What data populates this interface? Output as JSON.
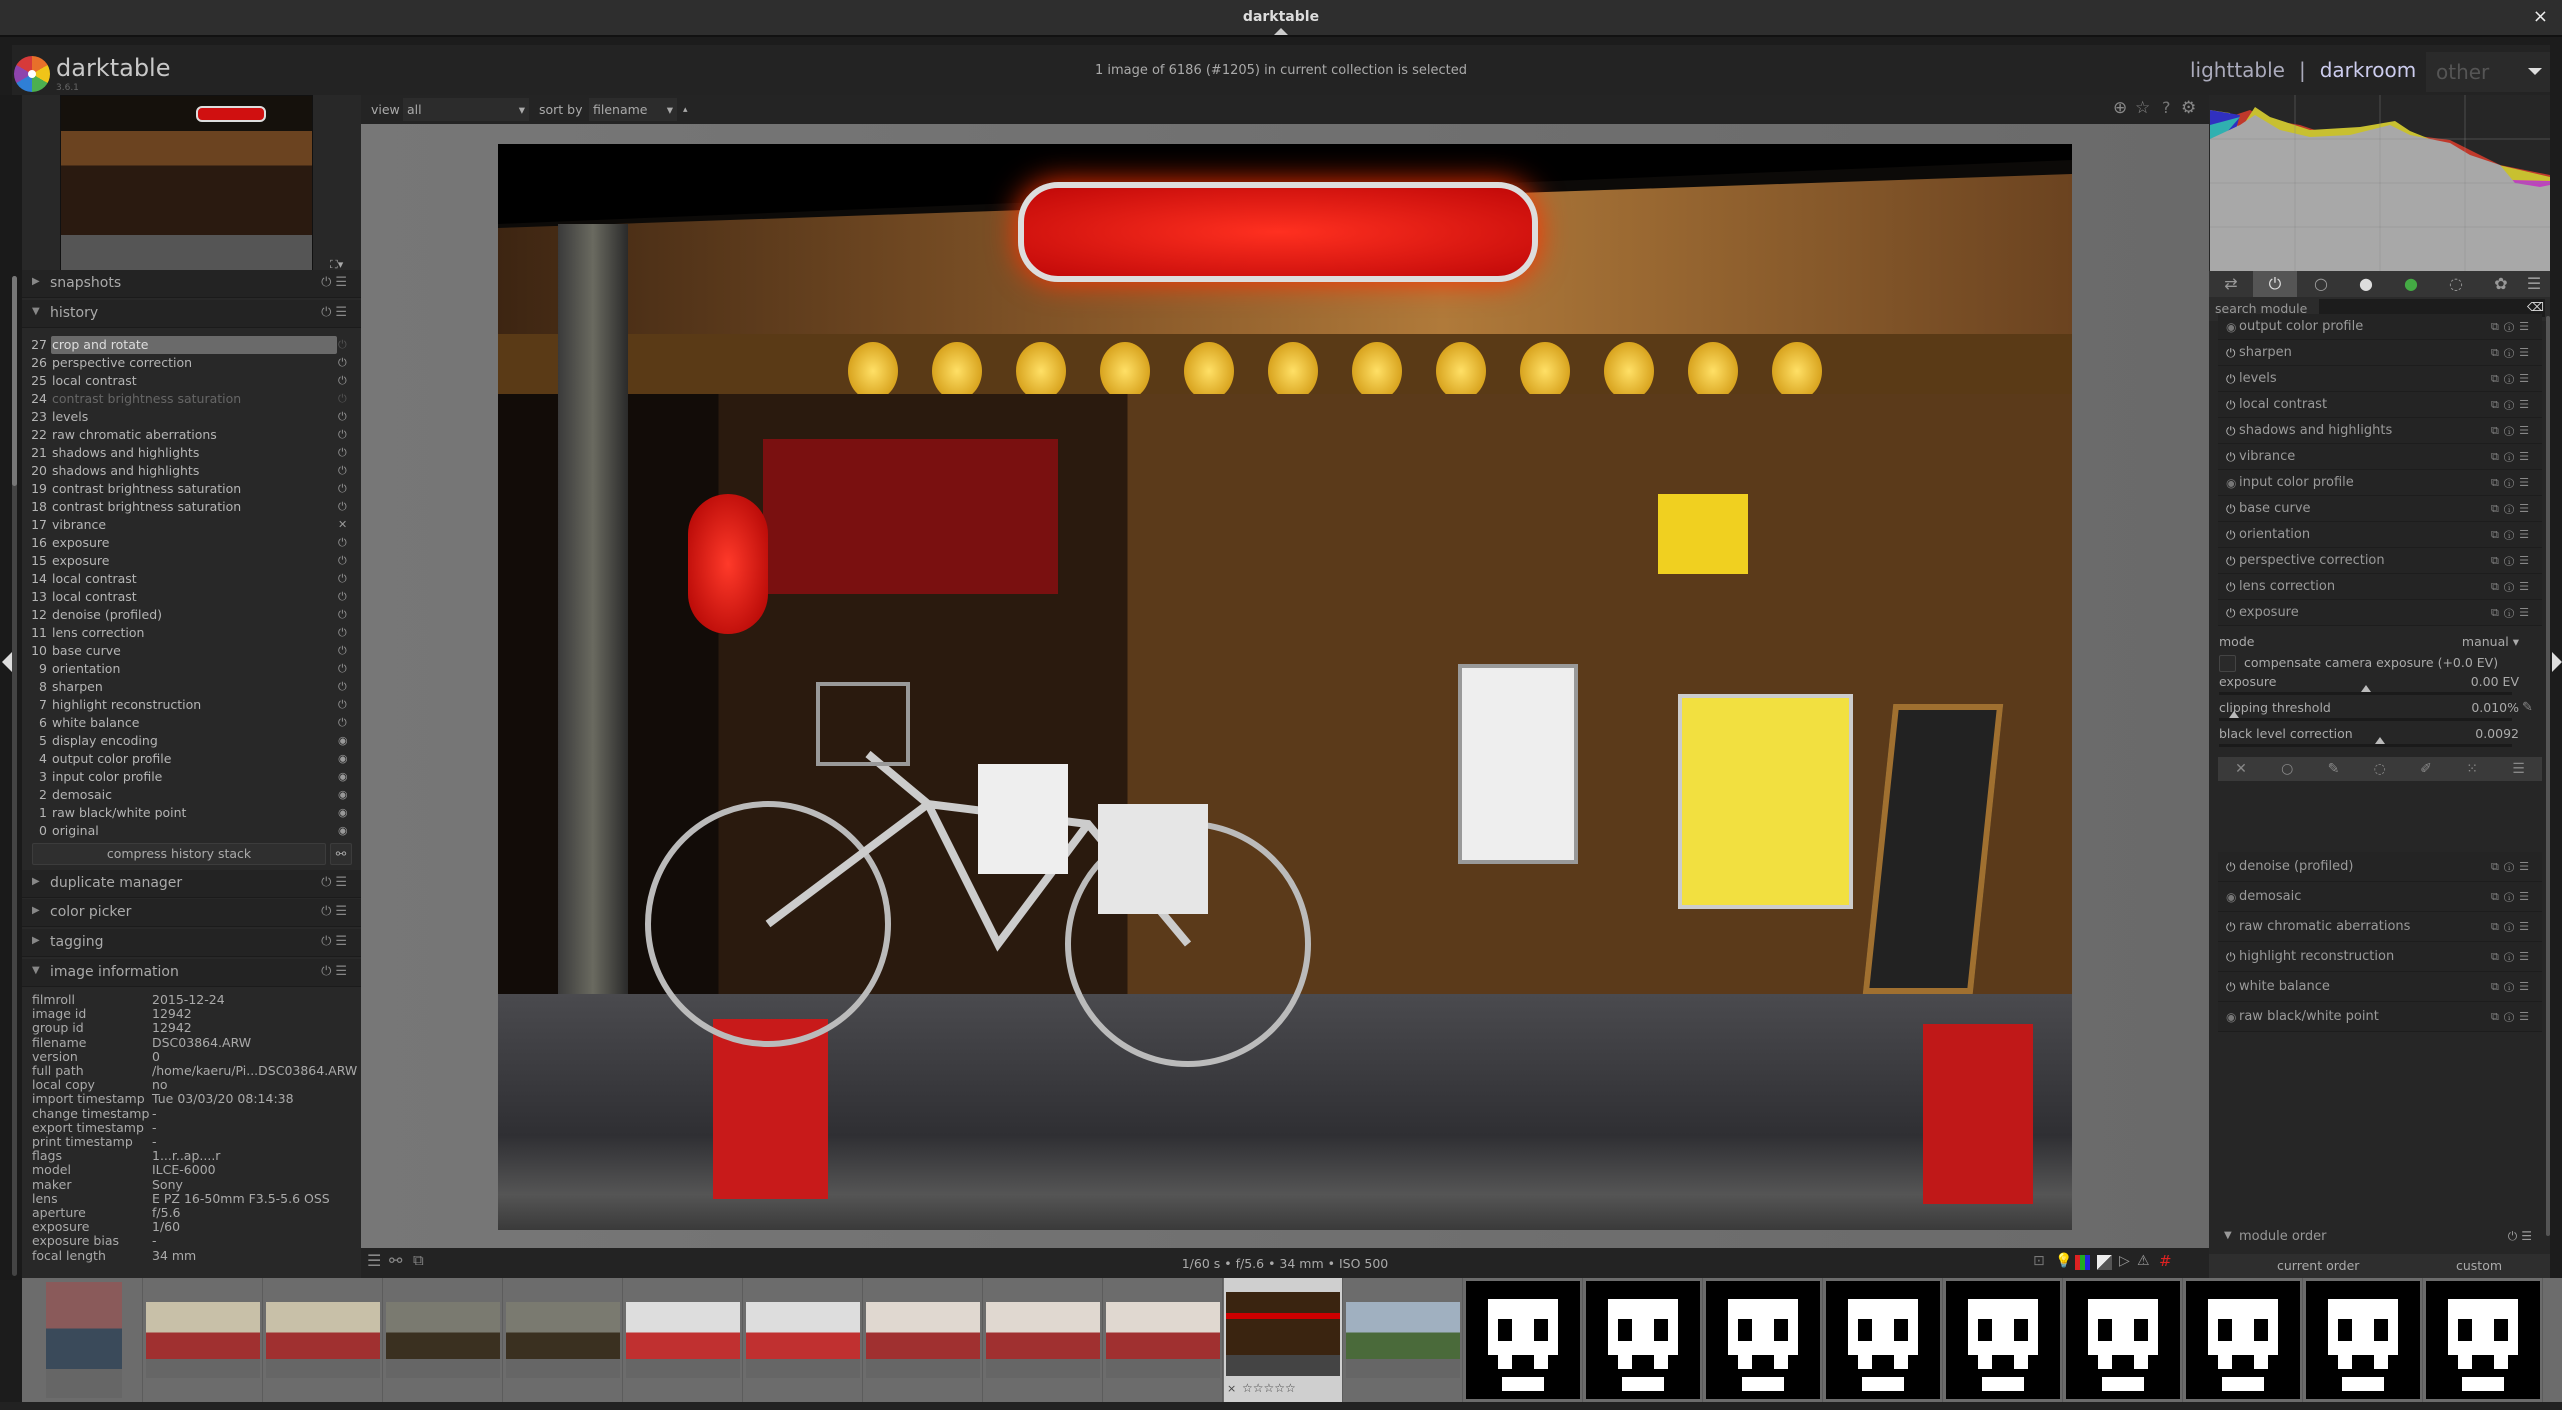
{
  "window": {
    "title": "darktable",
    "close": "×"
  },
  "header": {
    "brand": "darktable",
    "version": "3.6.1",
    "collection_status": "1 image of 6186 (#1205) in current collection is selected",
    "views": {
      "lighttable": "lighttable",
      "sep": "|",
      "darkroom": "darkroom",
      "other": "other"
    }
  },
  "toolbar": {
    "view_label": "view",
    "view_value": "all",
    "sort_label": "sort by",
    "sort_value": "filename",
    "sort_dir": "▴"
  },
  "left_panel": {
    "snapshots": "snapshots",
    "history_title": "history",
    "history": [
      {
        "n": "27",
        "label": "crop and rotate",
        "state": "off-dim",
        "selected": true
      },
      {
        "n": "26",
        "label": "perspective correction",
        "state": "on"
      },
      {
        "n": "25",
        "label": "local contrast",
        "state": "on"
      },
      {
        "n": "24",
        "label": "contrast brightness saturation",
        "state": "off-dim",
        "dim": true
      },
      {
        "n": "23",
        "label": "levels",
        "state": "on"
      },
      {
        "n": "22",
        "label": "raw chromatic aberrations",
        "state": "on"
      },
      {
        "n": "21",
        "label": "shadows and highlights",
        "state": "on"
      },
      {
        "n": "20",
        "label": "shadows and highlights",
        "state": "on"
      },
      {
        "n": "19",
        "label": "contrast brightness saturation",
        "state": "on"
      },
      {
        "n": "18",
        "label": "contrast brightness saturation",
        "state": "on"
      },
      {
        "n": "17",
        "label": "vibrance",
        "state": "deleted"
      },
      {
        "n": "16",
        "label": "exposure",
        "state": "on"
      },
      {
        "n": "15",
        "label": "exposure",
        "state": "on"
      },
      {
        "n": "14",
        "label": "local contrast",
        "state": "on"
      },
      {
        "n": "13",
        "label": "local contrast",
        "state": "on"
      },
      {
        "n": "12",
        "label": "denoise (profiled)",
        "state": "on"
      },
      {
        "n": "11",
        "label": "lens correction",
        "state": "on"
      },
      {
        "n": "10",
        "label": "base curve",
        "state": "on"
      },
      {
        "n": "9",
        "label": "orientation",
        "state": "on"
      },
      {
        "n": "8",
        "label": "sharpen",
        "state": "on"
      },
      {
        "n": "7",
        "label": "highlight reconstruction",
        "state": "on"
      },
      {
        "n": "6",
        "label": "white balance",
        "state": "on"
      },
      {
        "n": "5",
        "label": "display encoding",
        "state": "always"
      },
      {
        "n": "4",
        "label": "output color profile",
        "state": "always"
      },
      {
        "n": "3",
        "label": "input color profile",
        "state": "always"
      },
      {
        "n": "2",
        "label": "demosaic",
        "state": "always"
      },
      {
        "n": "1",
        "label": "raw black/white point",
        "state": "always"
      },
      {
        "n": "0",
        "label": "original",
        "state": "always"
      }
    ],
    "compress": "compress history stack",
    "duplicate_manager": "duplicate manager",
    "color_picker": "color picker",
    "tagging": "tagging",
    "image_information": "image information",
    "info": [
      {
        "k": "filmroll",
        "v": "2015-12-24"
      },
      {
        "k": "image id",
        "v": "12942"
      },
      {
        "k": "group id",
        "v": "12942"
      },
      {
        "k": "filename",
        "v": "DSC03864.ARW"
      },
      {
        "k": "version",
        "v": "0"
      },
      {
        "k": "full path",
        "v": "/home/kaeru/Pi...DSC03864.ARW"
      },
      {
        "k": "local copy",
        "v": "no"
      },
      {
        "k": "import timestamp",
        "v": "Tue 03/03/20 08:14:38"
      },
      {
        "k": "change timestamp",
        "v": "-"
      },
      {
        "k": "export timestamp",
        "v": "-"
      },
      {
        "k": "print timestamp",
        "v": "-"
      },
      {
        "k": "flags",
        "v": "1...r..ap....r"
      },
      {
        "k": "model",
        "v": "ILCE-6000"
      },
      {
        "k": "maker",
        "v": "Sony"
      },
      {
        "k": "lens",
        "v": "E PZ 16-50mm F3.5-5.6 OSS"
      },
      {
        "k": "aperture",
        "v": "f/5.6"
      },
      {
        "k": "exposure",
        "v": "1/60"
      },
      {
        "k": "exposure bias",
        "v": "-"
      },
      {
        "k": "focal length",
        "v": "34 mm"
      }
    ]
  },
  "bottom": {
    "exif": "1/60 s • f/5.6 • 34 mm • ISO 500"
  },
  "right_panel": {
    "search_label": "search module",
    "search_value": "",
    "modules_top": [
      {
        "label": "output color profile",
        "always": true
      },
      {
        "label": "sharpen"
      },
      {
        "label": "levels"
      },
      {
        "label": "local contrast"
      },
      {
        "label": "shadows and highlights"
      },
      {
        "label": "vibrance"
      },
      {
        "label": "input color profile",
        "always": true
      },
      {
        "label": "base curve"
      },
      {
        "label": "orientation"
      },
      {
        "label": "perspective correction"
      },
      {
        "label": "lens correction"
      },
      {
        "label": "exposure"
      }
    ],
    "exposure": {
      "mode_label": "mode",
      "mode_value": "manual",
      "compensate": "compensate camera exposure (+0.0 EV)",
      "compensate_checked": false,
      "exposure_label": "exposure",
      "exposure_value": "0.00 EV",
      "exposure_pos": 0.5,
      "clip_label": "clipping threshold",
      "clip_value": "0.010%",
      "clip_pos": 0.05,
      "black_label": "black level correction",
      "black_value": "0.0092",
      "black_pos": 0.55
    },
    "modules_bottom": [
      {
        "label": "denoise (profiled)"
      },
      {
        "label": "demosaic",
        "always": true
      },
      {
        "label": "raw chromatic aberrations"
      },
      {
        "label": "highlight reconstruction"
      },
      {
        "label": "white balance"
      },
      {
        "label": "raw black/white point",
        "always": true
      }
    ],
    "module_order": "module order",
    "current_order": "current order",
    "order_value": "custom"
  },
  "filmstrip": {
    "selected_index": 10,
    "reject": "×",
    "stars": "☆☆☆☆☆",
    "skull_count": 9
  }
}
